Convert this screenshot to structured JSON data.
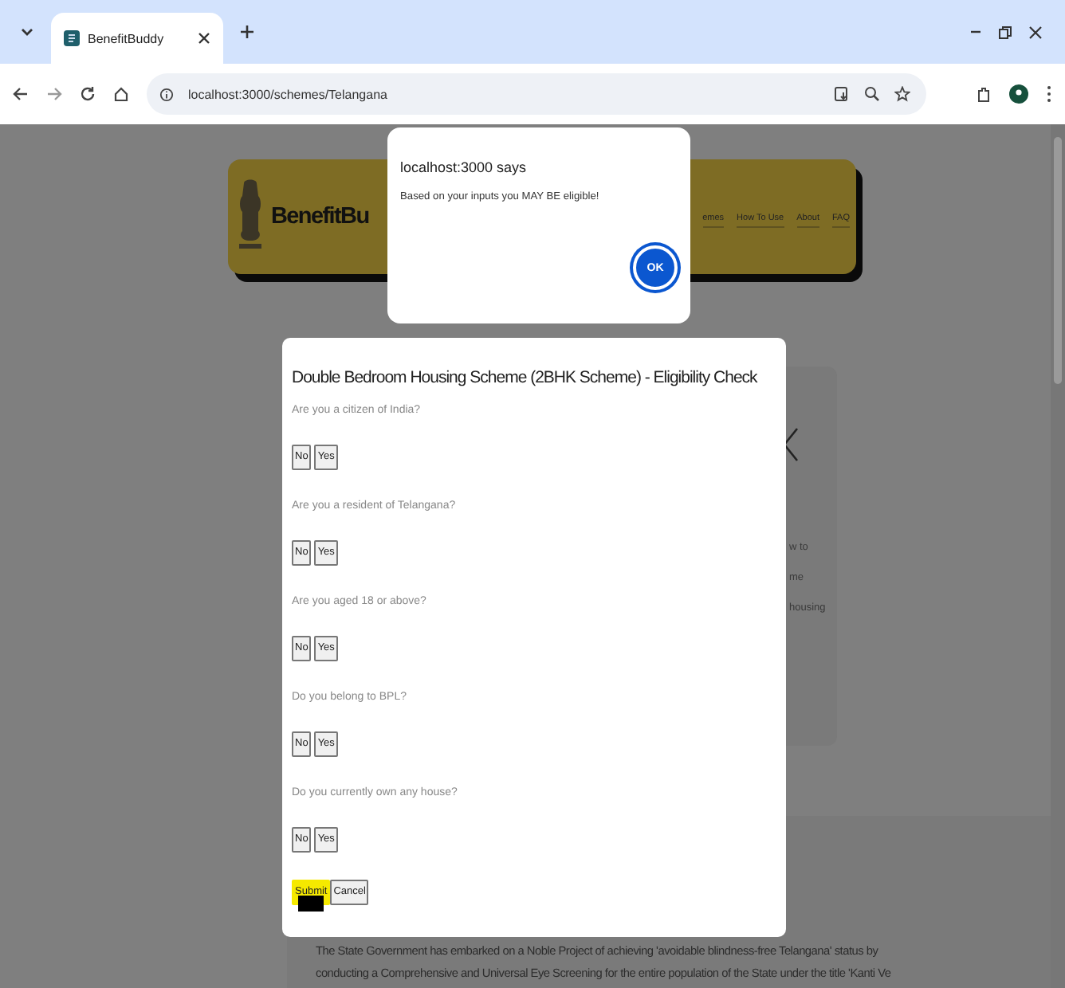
{
  "browser": {
    "tab_title": "BenefitBuddy",
    "url": "localhost:3000/schemes/Telangana"
  },
  "header": {
    "brand": "BenefitBu",
    "nav": [
      "emes",
      "How To Use",
      "About",
      "FAQ"
    ]
  },
  "background_card": {
    "side_texts": [
      "w to",
      "me",
      "housing"
    ]
  },
  "background_paragraph": [
    "The State Government has embarked on a Noble Project of achieving 'avoidable blindness-free Telangana' status by",
    "conducting a Comprehensive and Universal Eye Screening for the entire population of the State under the title 'Kanti Ve"
  ],
  "eligibility_modal": {
    "title": "Double Bedroom Housing Scheme (2BHK Scheme) - Eligibility Check",
    "questions": [
      {
        "text": "Are you a citizen of India?",
        "options": [
          "No",
          "Yes"
        ]
      },
      {
        "text": "Are you a resident of Telangana?",
        "options": [
          "No",
          "Yes"
        ]
      },
      {
        "text": "Are you aged 18 or above?",
        "options": [
          "No",
          "Yes"
        ]
      },
      {
        "text": "Do you belong to BPL?",
        "options": [
          "No",
          "Yes"
        ]
      },
      {
        "text": "Do you currently own any house?",
        "options": [
          "No",
          "Yes"
        ]
      }
    ],
    "buttons": [
      "Submit",
      "Cancel"
    ]
  },
  "alert": {
    "title": "localhost:3000 says",
    "message": "Based on your inputs you MAY BE eligible!",
    "button": "OK"
  }
}
